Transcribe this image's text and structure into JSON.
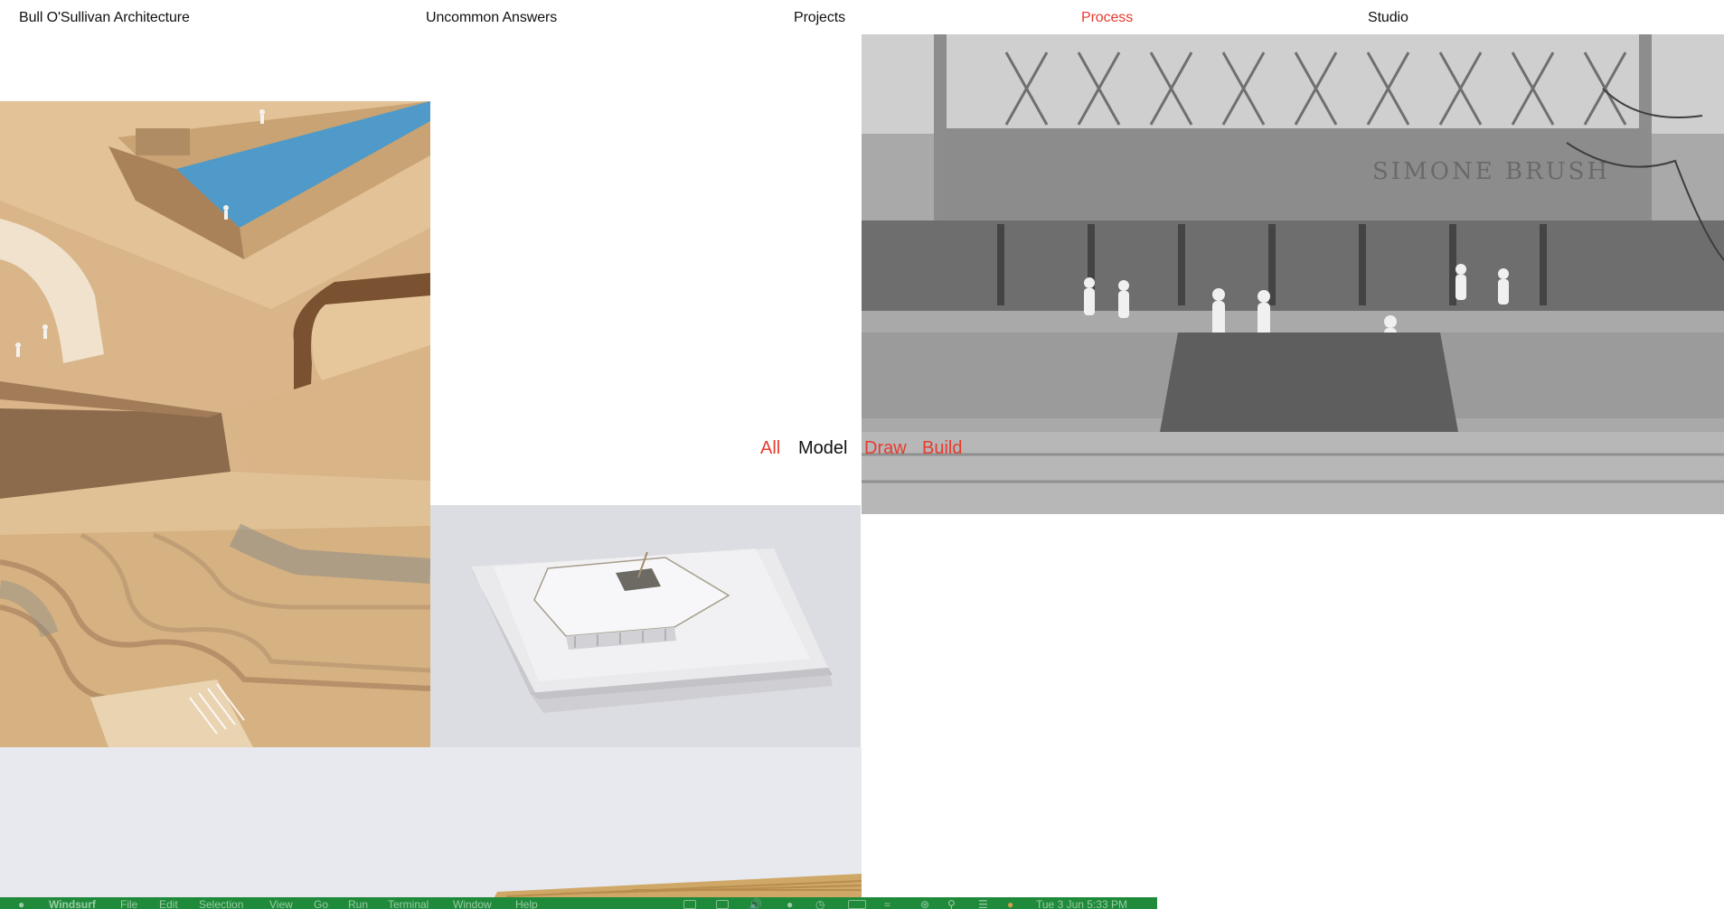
{
  "colors": {
    "accent": "#e63b2e",
    "text": "#111111",
    "menubar_bg": "#1f8a3a"
  },
  "site": {
    "brand": "Bull O'Sullivan Architecture"
  },
  "nav": {
    "uncommon": "Uncommon Answers",
    "projects": "Projects",
    "process": "Process",
    "studio": "Studio",
    "active": "Process"
  },
  "filters": {
    "all": "All",
    "model": "Model",
    "draw": "Draw",
    "build": "Build",
    "selected": "Model"
  },
  "images": {
    "topo": "topographic-wood-model-photo",
    "pavilion": "white-pavilion-model-photo",
    "bottom": "wood-model-edge-photo",
    "street": "grayscale-street-model-photo",
    "street_sign": "SIMONE BRUSH"
  },
  "menubar": {
    "app": "Windsurf",
    "file": "File",
    "edit": "Edit",
    "selection": "Selection",
    "view": "View",
    "go": "Go",
    "run": "Run",
    "terminal": "Terminal",
    "window": "Window",
    "help": "Help",
    "clock": "Tue 3 Jun  5:33 PM"
  }
}
